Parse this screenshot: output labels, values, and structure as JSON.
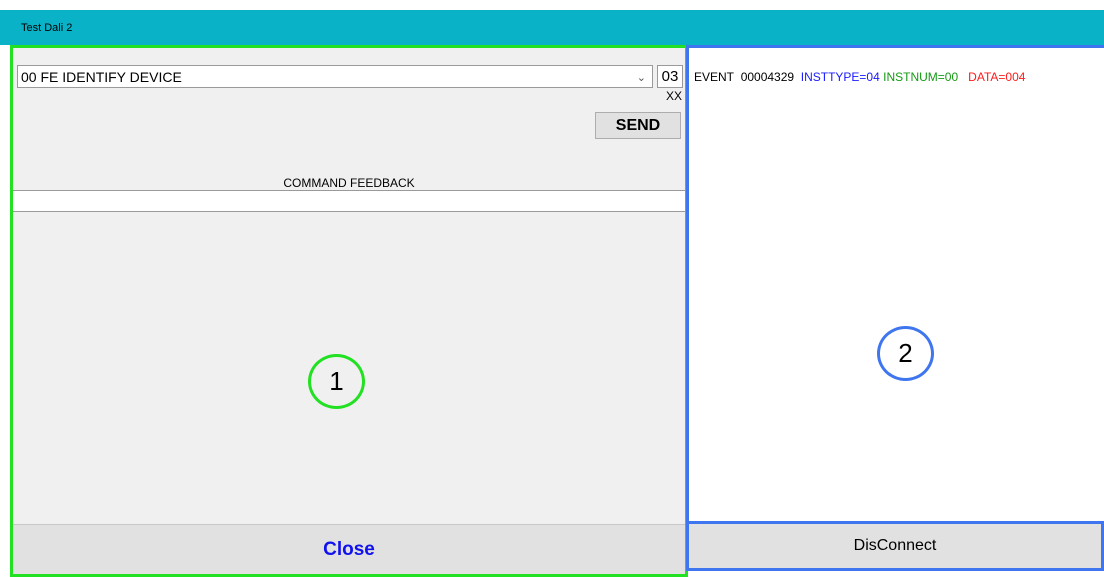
{
  "window": {
    "title": "Test Dali 2"
  },
  "left_panel": {
    "command_select": {
      "value": "00 FE IDENTIFY DEVICE"
    },
    "number_box": {
      "value": "03"
    },
    "xx_label": "XX",
    "send_label": "SEND",
    "feedback_label": "COMMAND FEEDBACK",
    "feedback_value": "",
    "close_label": "Close",
    "callout": "1"
  },
  "right_panel": {
    "event": {
      "word": "EVENT",
      "id": "00004329",
      "insttype": "INSTTYPE=04",
      "instnum": "INSTNUM=00",
      "data": "DATA=004"
    },
    "callout": "2",
    "disconnect_label": "DisConnect"
  },
  "colors": {
    "titlebar": "#09b2c7",
    "left_highlight": "#22e022",
    "right_highlight": "#3f76f0",
    "insttype": "#1a1aff",
    "instnum": "#159915",
    "data": "#ff1a1a",
    "close_text": "#1111ee"
  }
}
